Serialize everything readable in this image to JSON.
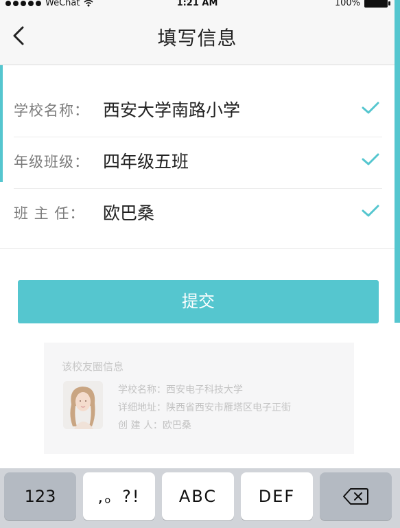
{
  "status_bar": {
    "carrier": "WeChat",
    "time": "1:21 AM",
    "battery": "100%"
  },
  "nav": {
    "title": "填写信息"
  },
  "form": {
    "rows": [
      {
        "label": "学校名称：",
        "value": "西安大学南路小学"
      },
      {
        "label": "年级班级：",
        "value": "四年级五班"
      },
      {
        "label": "班  主  任：",
        "value": "欧巴桑"
      }
    ]
  },
  "submit_label": "提交",
  "alumni_card": {
    "title": "该校友圈信息",
    "school_label": "学校名称：",
    "school_value": "西安电子科技大学",
    "address_label": "详细地址：",
    "address_value": "陕西省西安市雁塔区电子正街",
    "creator_label": "创  建  人：",
    "creator_value": "欧巴桑"
  },
  "keyboard": {
    "keys": [
      "123",
      ",。?!",
      "ABC",
      "DEF"
    ],
    "delete_icon": "backspace-icon"
  },
  "colors": {
    "accent": "#55c6cf",
    "keyboard_bg": "#d1d4d9"
  }
}
